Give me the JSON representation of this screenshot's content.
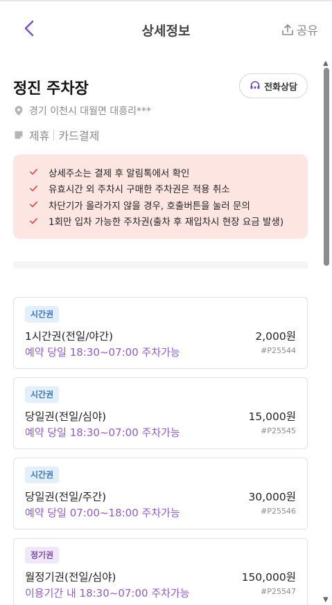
{
  "header": {
    "title": "상세정보",
    "share_label": "공유"
  },
  "lot": {
    "name": "정진 주차장",
    "call_label": "전화상담",
    "address": "경기 이천시 대월면 대흥리***",
    "tags": [
      "제휴",
      "카드결제"
    ]
  },
  "notices": [
    "상세주소는 결제 후 알림톡에서 확인",
    "유효시간 외 주차시 구매한 주차권은 적용 취소",
    "차단기가 올라가지 않을 경우, 호출버튼을 눌러 문의",
    "1회만 입차 가능한 주차권(출차 후 재입차시 현장 요금 발생)"
  ],
  "tickets": [
    {
      "badge": "시간권",
      "name": "1시간권(전일/야간)",
      "price": "2,000원",
      "desc": "예약 당일 18:30~07:00 주차가능",
      "code": "#P25544"
    },
    {
      "badge": "시간권",
      "name": "당일권(전일/심야)",
      "price": "15,000원",
      "desc": "예약 당일 18:30~07:00 주차가능",
      "code": "#P25545"
    },
    {
      "badge": "시간권",
      "name": "당일권(전일/주간)",
      "price": "30,000원",
      "desc": "예약 당일 07:00~18:00 주차가능",
      "code": "#P25546"
    },
    {
      "badge": "정기권",
      "name": "월정기권(전일/심야)",
      "price": "150,000원",
      "desc": "이용기간 내 18:30~07:00 주차가능",
      "code": "#P25547"
    }
  ],
  "colors": {
    "accent": "#8e5cc0",
    "notice_bg": "#fde5e2",
    "check": "#d9534f"
  }
}
